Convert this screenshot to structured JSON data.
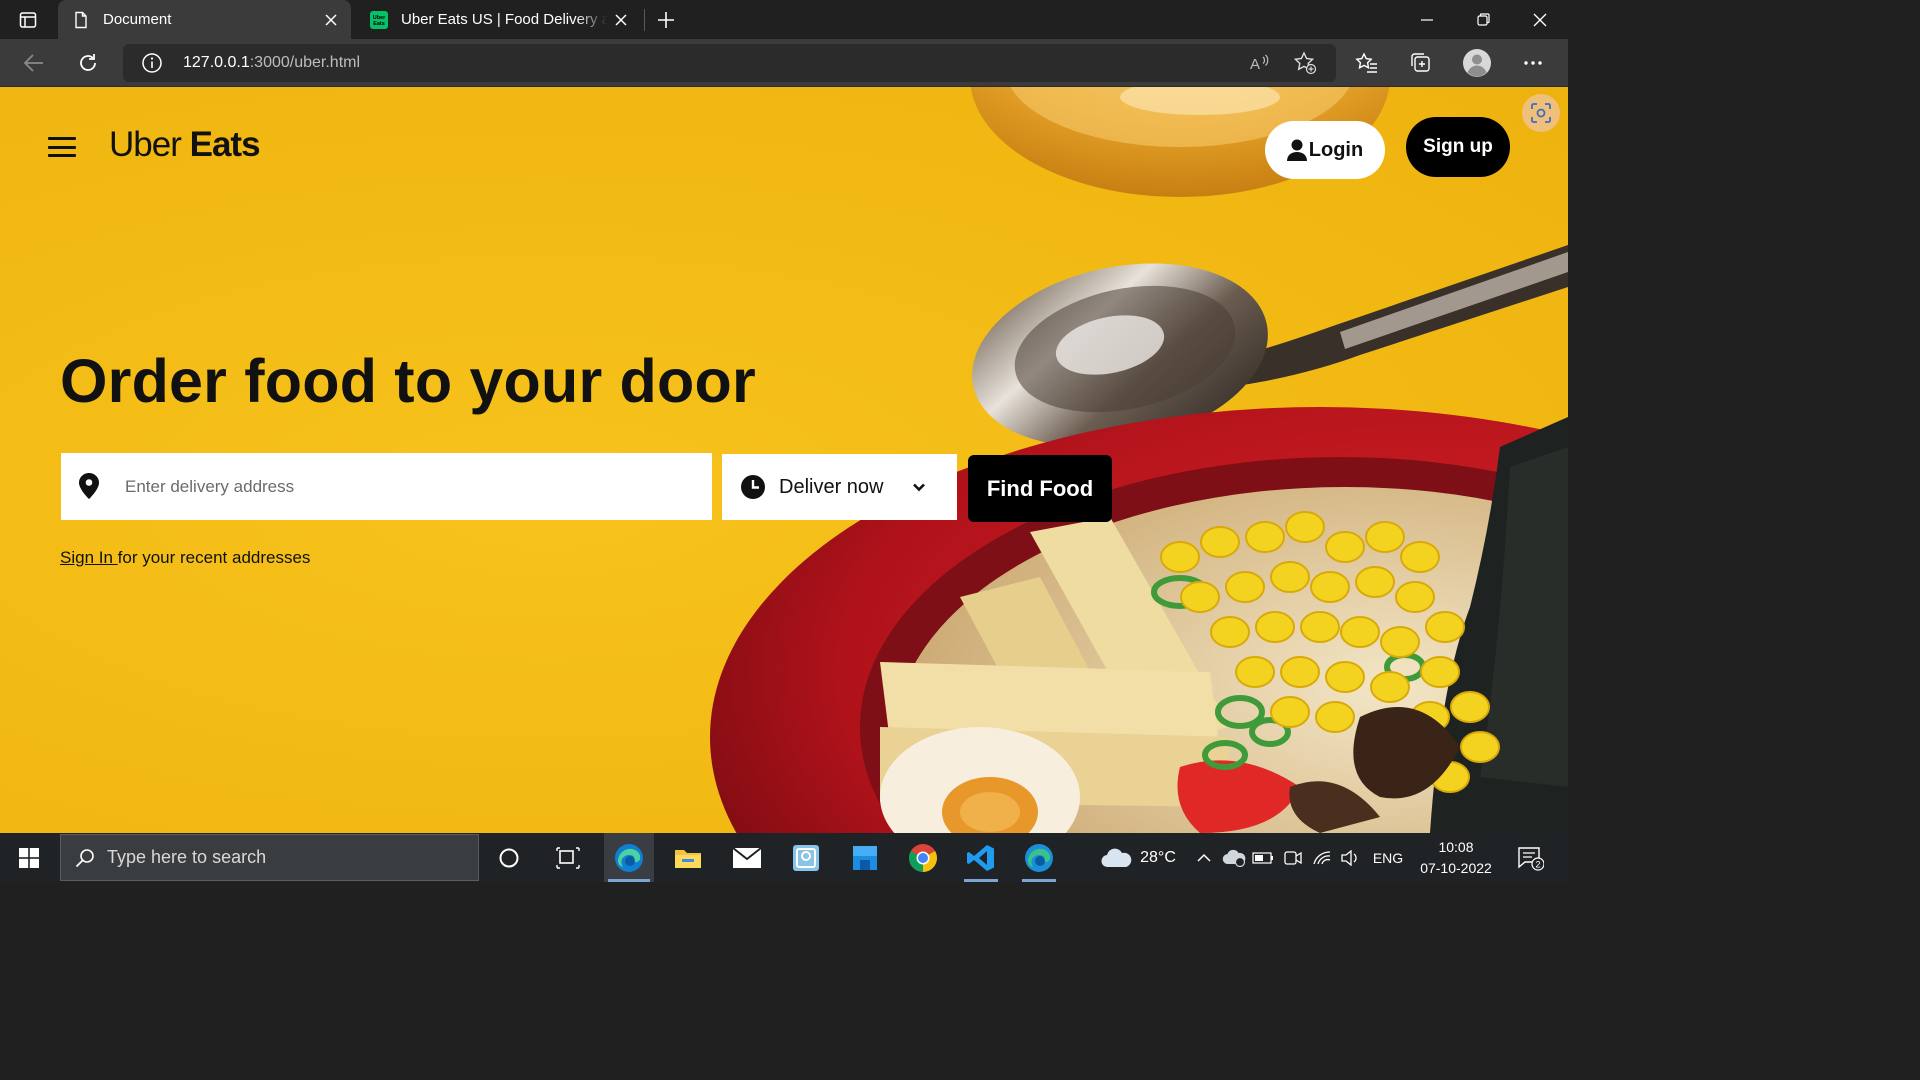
{
  "browser": {
    "tabs": [
      {
        "title": "Document",
        "active": true
      },
      {
        "title": "Uber Eats US | Food Delivery and Takeout",
        "active": false
      }
    ],
    "url": {
      "host": "127.0.0.1",
      "rest": ":3000/uber.html"
    }
  },
  "page": {
    "logo": {
      "light": "Uber",
      "bold": "Eats"
    },
    "login_label": "Login",
    "signup_label": "Sign up",
    "hero_title": "Order food to your door",
    "address_placeholder": "Enter delivery address",
    "deliver_label": "Deliver now",
    "find_food_label": "Find Food",
    "signin_link": "Sign In ",
    "signin_suffix": "for your recent addresses",
    "colors": {
      "hero_yellow": "#f3bb15",
      "button_black": "#000000"
    }
  },
  "taskbar": {
    "search_placeholder": "Type here to search",
    "weather": "28°C",
    "language": "ENG",
    "time": "10:08",
    "date": "07-10-2022",
    "notification_count": "2",
    "pinned_apps": [
      "cortana-icon",
      "task-view-icon",
      "edge-icon",
      "file-explorer-icon",
      "mail-icon",
      "photos-icon",
      "store-icon",
      "chrome-icon",
      "vscode-icon",
      "edge-dev-icon"
    ]
  }
}
